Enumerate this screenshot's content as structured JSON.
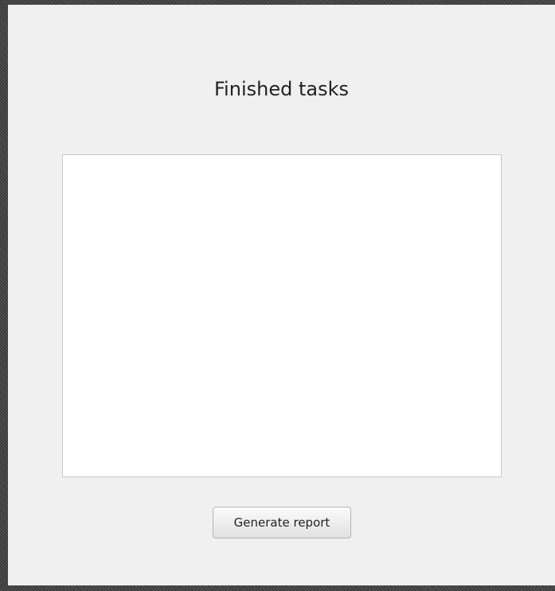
{
  "window": {
    "title": "Finished tasks"
  },
  "tasks_list": {
    "items": []
  },
  "actions": {
    "generate_report_label": "Generate report"
  },
  "colors": {
    "background": "#f0f0f0",
    "list_background": "#ffffff",
    "list_border": "#c8c8c8",
    "text": "#222222"
  }
}
